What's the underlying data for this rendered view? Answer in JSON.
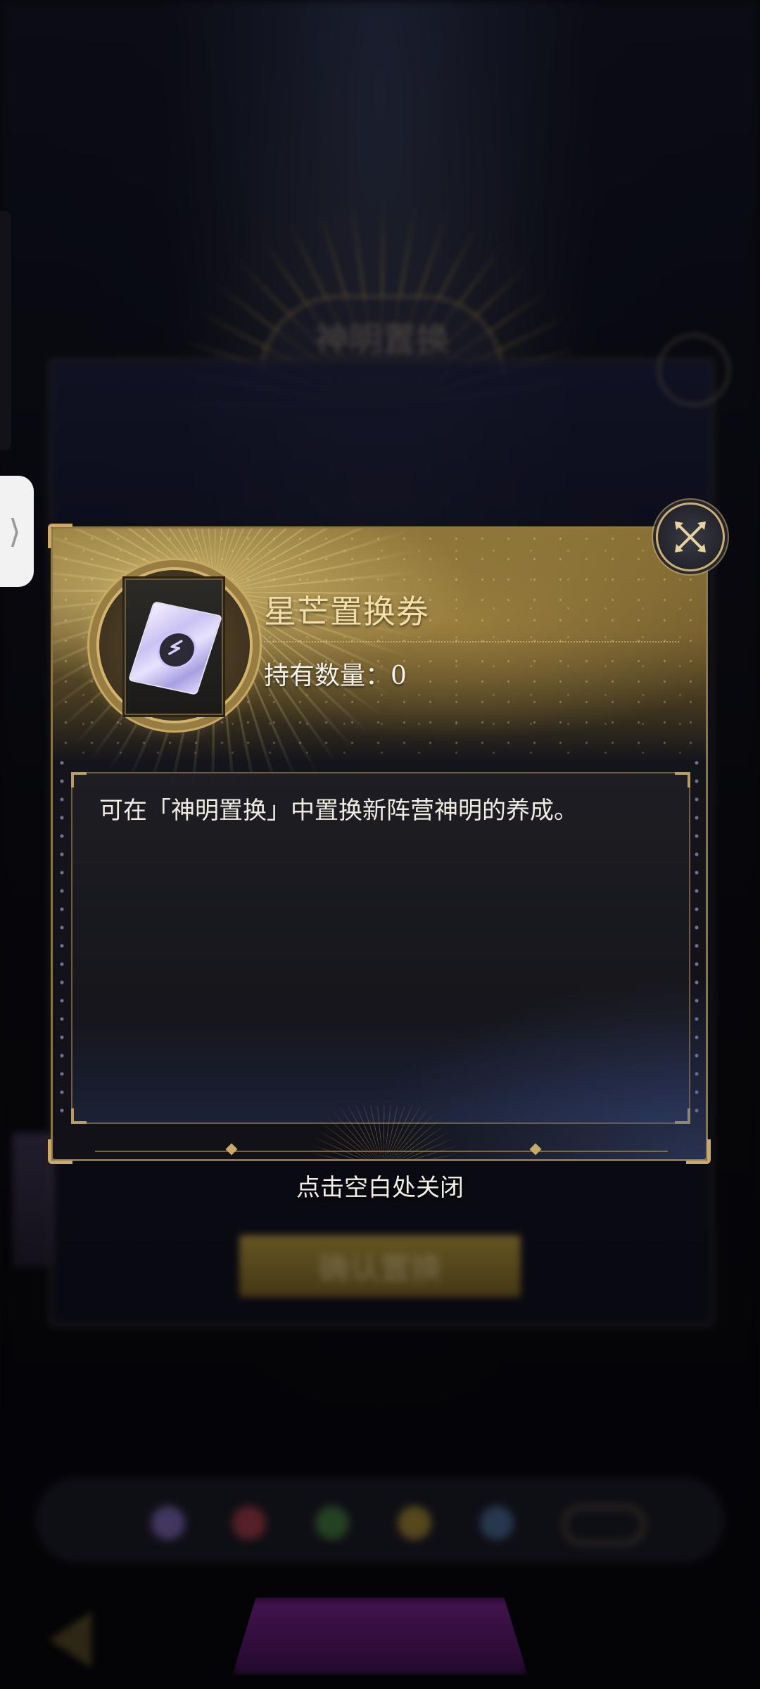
{
  "background": {
    "title": "神明置换",
    "subtitle": "",
    "confirm_label": "确认置换",
    "hint": "",
    "bottom_button_label": ""
  },
  "modal": {
    "item_name": "星芒置换券",
    "count_label": "持有数量：",
    "count_value": "0",
    "description": "可在「神明置换」中置换新阵营神明的养成。",
    "item_icon": "ticket-icon",
    "close_icon": "close-icon"
  },
  "side_handle": {
    "glyph": "⟩"
  },
  "tap_hint": "点击空白处关闭",
  "colors": {
    "accent_gold": "#d2b46c",
    "title_gold": "#f3dea8",
    "panel_dark": "#111117"
  }
}
